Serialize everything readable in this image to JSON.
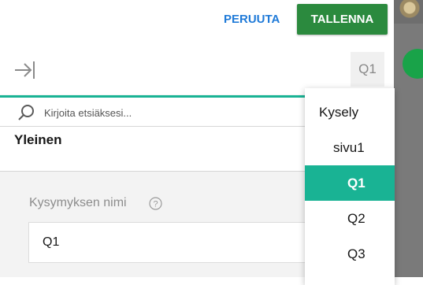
{
  "toolbar": {
    "cancel_label": "PERUUTA",
    "save_label": "TALLENNA"
  },
  "question_chip": "Q1",
  "search": {
    "placeholder": "Kirjoita etsiäksesi..."
  },
  "section": {
    "title": "Yleinen"
  },
  "field": {
    "label": "Kysymyksen nimi",
    "value": "Q1"
  },
  "dropdown": {
    "items": [
      {
        "label": "Kysely"
      },
      {
        "label": "sivu1"
      },
      {
        "label": "Q1",
        "selected": true
      },
      {
        "label": "Q2"
      },
      {
        "label": "Q3"
      }
    ]
  },
  "colors": {
    "accent": "#19b394",
    "save_button": "#2b8a3e",
    "link": "#1f7ad8"
  },
  "icons": [
    "collapse-panel-icon",
    "search-icon",
    "help-icon"
  ]
}
